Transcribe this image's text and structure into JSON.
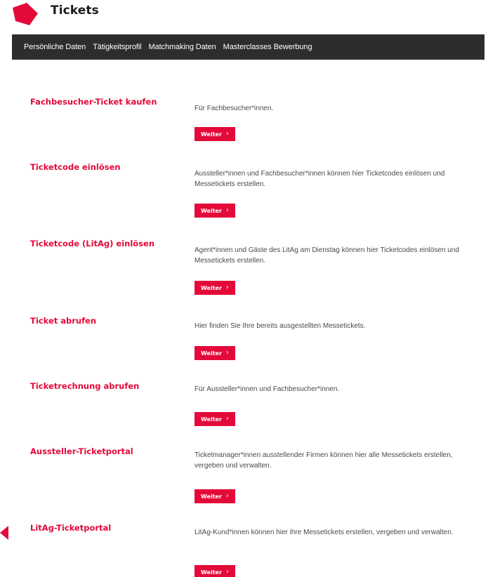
{
  "header": {
    "title": "Tickets",
    "logo_color": "#e30a3a"
  },
  "nav": {
    "items": [
      {
        "label": "Persönliche Daten"
      },
      {
        "label": "Tätigkeitsprofil"
      },
      {
        "label": "Matchmaking Daten"
      },
      {
        "label": "Masterclasses Bewerbung"
      }
    ]
  },
  "sections": [
    {
      "title": "Fachbesucher-Ticket kaufen",
      "description": "Für Fachbesucher*innen.",
      "button_label": "Weiter"
    },
    {
      "title": "Ticketcode einlösen",
      "description": "Aussteller*innen und Fachbesucher*innen können hier Ticketcodes einlösen und Messetickets erstellen.",
      "button_label": "Weiter"
    },
    {
      "title": "Ticketcode (LitAg) einlösen",
      "description": "Agent*innen und Gäste des LitAg am Dienstag können hier Ticketcodes einlösen und Messetickets erstellen.",
      "button_label": "Weiter"
    },
    {
      "title": "Ticket abrufen",
      "description": "Hier finden Sie Ihre bereits ausgestellten Messetickets.",
      "button_label": "Weiter"
    },
    {
      "title": "Ticketrechnung abrufen",
      "description": "Für Aussteller*innen und Fachbesucher*innen.",
      "button_label": "Weiter"
    },
    {
      "title": "Aussteller-Ticketportal",
      "description": "Ticketmanager*innen ausstellender Firmen können hier alle Messetickets erstellen, vergeben und verwalten.",
      "button_label": "Weiter"
    },
    {
      "title": "LitAg-Ticketportal",
      "description": "LitAg-Kund*innen können hier ihre Messetickets erstellen, vergeben und verwalten.",
      "button_label": "Weiter"
    }
  ],
  "colors": {
    "accent": "#e30a3a",
    "nav_background": "#2d2d2d"
  }
}
